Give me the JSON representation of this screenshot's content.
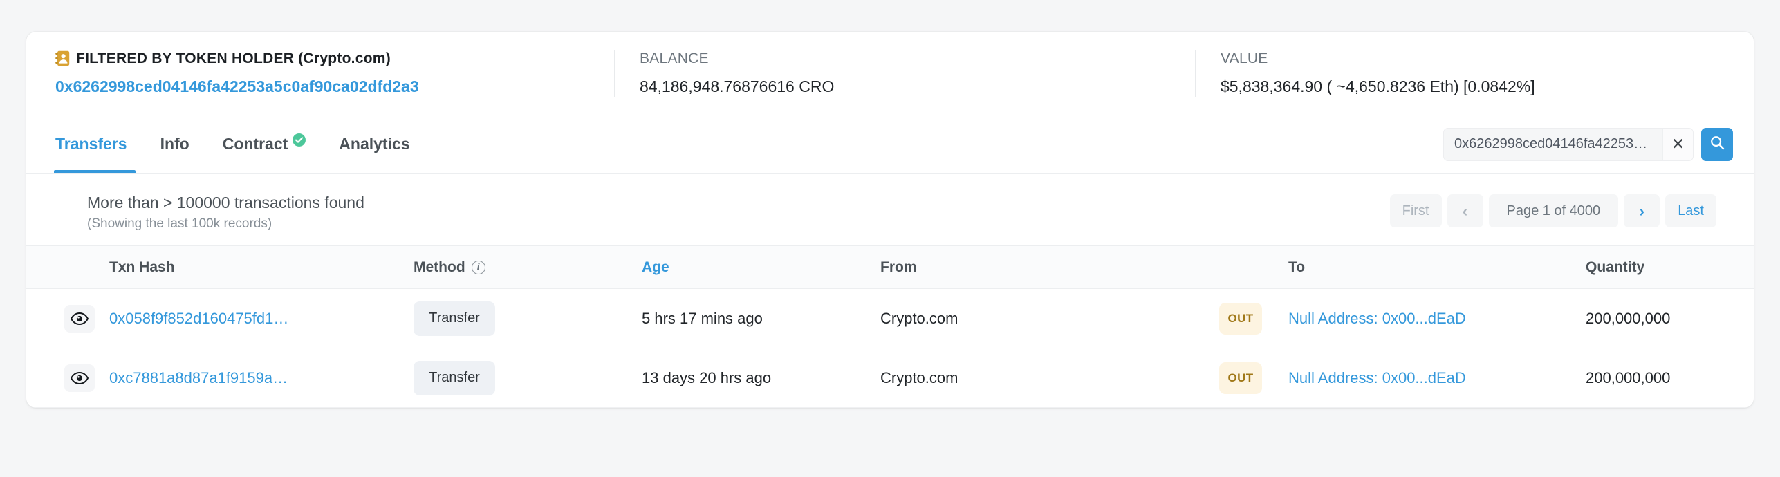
{
  "summary": {
    "holder": {
      "icon": "address-book-icon",
      "label": "FILTERED BY TOKEN HOLDER (Crypto.com)",
      "address": "0x6262998ced04146fa42253a5c0af90ca02dfd2a3"
    },
    "balance": {
      "label": "BALANCE",
      "value": "84,186,948.76876616 CRO"
    },
    "value": {
      "label": "VALUE",
      "value": "$5,838,364.90 ( ~4,650.8236 Eth) [0.0842%]"
    }
  },
  "tabs": [
    {
      "label": "Transfers",
      "active": true,
      "verified": false
    },
    {
      "label": "Info",
      "active": false,
      "verified": false
    },
    {
      "label": "Contract",
      "active": false,
      "verified": true
    },
    {
      "label": "Analytics",
      "active": false,
      "verified": false
    }
  ],
  "search": {
    "value": "0x6262998ced04146fa42253…",
    "placeholder": "Search",
    "clear_label": "✕",
    "icon": "search-icon"
  },
  "toolbar": {
    "count_main": "More than > 100000 transactions found",
    "count_sub": "(Showing the last 100k records)",
    "pager": {
      "first": "First",
      "prev": "‹",
      "page_label": "Page 1 of 4000",
      "next": "›",
      "last": "Last"
    }
  },
  "table": {
    "columns": [
      {
        "key": "eye",
        "label": ""
      },
      {
        "key": "hash",
        "label": "Txn Hash"
      },
      {
        "key": "method",
        "label": "Method",
        "info": true
      },
      {
        "key": "age",
        "label": "Age",
        "sortable": true
      },
      {
        "key": "from",
        "label": "From"
      },
      {
        "key": "dir",
        "label": ""
      },
      {
        "key": "to",
        "label": "To"
      },
      {
        "key": "quantity",
        "label": "Quantity"
      }
    ],
    "rows": [
      {
        "hash": "0x058f9f852d160475fd1…",
        "method": "Transfer",
        "age": "5 hrs 17 mins ago",
        "from": "Crypto.com",
        "direction": "OUT",
        "to": "Null Address: 0x00...dEaD",
        "quantity": "200,000,000"
      },
      {
        "hash": "0xc7881a8d87a1f9159a…",
        "method": "Transfer",
        "age": "13 days 20 hrs ago",
        "from": "Crypto.com",
        "direction": "OUT",
        "to": "Null Address: 0x00...dEaD",
        "quantity": "200,000,000"
      }
    ]
  },
  "colors": {
    "accent": "#3498db",
    "verified": "#4cc79a",
    "badge_bg": "#fdf4e1",
    "badge_fg": "#a07818",
    "holder_icon": "#d9a233"
  }
}
